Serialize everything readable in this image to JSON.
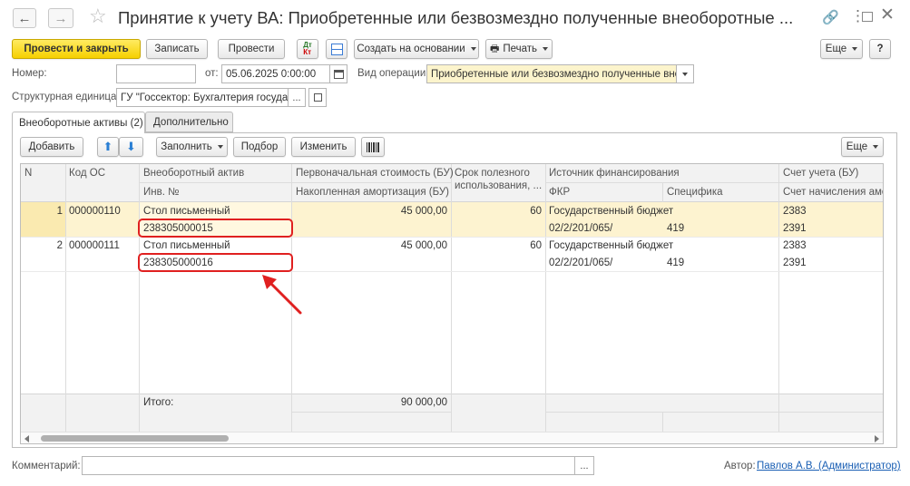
{
  "window": {
    "title": "Принятие к учету ВА: Приобретенные или безвозмездно полученные внеоборотные ...",
    "nav_back_icon": "arrow-left-icon",
    "nav_fwd_icon": "arrow-right-icon"
  },
  "toolbar": {
    "post_close": "Провести и закрыть",
    "save": "Записать",
    "post": "Провести",
    "create_based": "Создать на основании",
    "print": "Печать",
    "more": "Еще",
    "help": "?"
  },
  "form": {
    "number_label": "Номер:",
    "number_value": "",
    "date_label": "от:",
    "date_value": "05.06.2025  0:00:00",
    "op_label": "Вид операции:",
    "op_value": "Приобретенные или безвозмездно полученные внео",
    "unit_label": "Структурная единица:",
    "unit_value": "ГУ \"Госсектор: Бухгалтерия государ",
    "dots": "..."
  },
  "tabs": [
    {
      "label": "Внеоборотные активы (2)"
    },
    {
      "label": "Дополнительно"
    }
  ],
  "table_toolbar": {
    "add": "Добавить",
    "fill": "Заполнить",
    "select": "Подбор",
    "change": "Изменить",
    "more": "Еще"
  },
  "table": {
    "headers": {
      "n": "N",
      "code": "Код ОС",
      "asset": "Внеоборотный актив",
      "inv": "Инв. №",
      "cost": "Первоначальная стоимость (БУ)",
      "depr": "Накопленная амортизация (БУ)",
      "life1": "Срок полезного",
      "life2": "использования, ...",
      "source": "Источник финансирования",
      "fkr": "ФКР",
      "spec": "Специфика",
      "acc": "Счет учета (БУ)",
      "acc_depr": "Счет начисления амор"
    },
    "rows": [
      {
        "n": "1",
        "code": "000000110",
        "asset": "Стол письменный",
        "inv": "238305000015",
        "cost": "45 000,00",
        "life": "60",
        "source": "Государственный бюджет",
        "fkr": "02/2/201/065/",
        "spec": "419",
        "acc": "2383",
        "acc_depr": "2391"
      },
      {
        "n": "2",
        "code": "000000111",
        "asset": "Стол письменный",
        "inv": "238305000016",
        "cost": "45 000,00",
        "life": "60",
        "source": "Государственный бюджет",
        "fkr": "02/2/201/065/",
        "spec": "419",
        "acc": "2383",
        "acc_depr": "2391"
      }
    ],
    "total_label": "Итого:",
    "total_value": "90 000,00"
  },
  "footer": {
    "comment_label": "Комментарий:",
    "comment_value": "",
    "author_label": "Автор:",
    "author_value": "Павлов А.В. (Администратор)"
  },
  "colors": {
    "accent_yellow": "#f6d000",
    "selected_row": "#fdf3d0",
    "highlight_red": "#e02020",
    "link_blue": "#1a5fb4"
  }
}
